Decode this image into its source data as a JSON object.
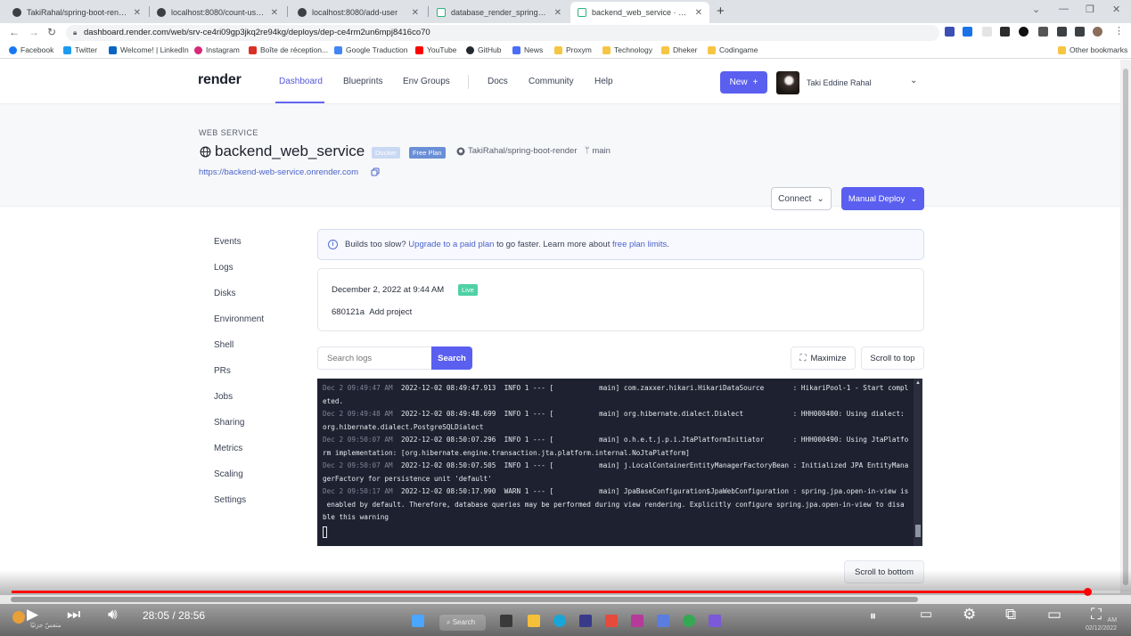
{
  "browser": {
    "tabs": [
      {
        "title": "TakiRahal/spring-boot-render: D",
        "favicon": "github-icon"
      },
      {
        "title": "localhost:8080/count-users",
        "favicon": "globe-icon"
      },
      {
        "title": "localhost:8080/add-user",
        "favicon": "globe-icon"
      },
      {
        "title": "database_render_spring_boot · D",
        "favicon": "render-icon"
      },
      {
        "title": "backend_web_service · Web Serv",
        "favicon": "render-icon",
        "active": true
      }
    ],
    "new_tab": "+",
    "window_controls": [
      "⌄",
      "—",
      "❐",
      "✕"
    ],
    "url": "dashboard.render.com/web/srv-ce4ri09gp3jkq2re94kg/deploys/dep-ce4rm2un6mpj8416co70",
    "bookmarks": [
      {
        "label": "Facebook",
        "color": "#1877f2"
      },
      {
        "label": "Twitter",
        "color": "#1d9bf0"
      },
      {
        "label": "Welcome! | LinkedIn",
        "color": "#0a66c2"
      },
      {
        "label": "Instagram",
        "color": "#d62976"
      },
      {
        "label": "Boîte de réception...",
        "color": "#d93025"
      },
      {
        "label": "Google Traduction",
        "color": "#4285f4"
      },
      {
        "label": "YouTube",
        "color": "#ff0000"
      },
      {
        "label": "GitHub",
        "color": "#24292f"
      },
      {
        "label": "News",
        "color": "#4a6cf7"
      },
      {
        "label": "Proxym",
        "color": "#f6c543"
      },
      {
        "label": "Technology",
        "color": "#f6c543"
      },
      {
        "label": "Dheker",
        "color": "#f6c543"
      },
      {
        "label": "Codingame",
        "color": "#f6c543"
      }
    ],
    "other_bookmarks": "Other bookmarks"
  },
  "render": {
    "logo": "render",
    "nav": [
      "Dashboard",
      "Blueprints",
      "Env Groups",
      "Docs",
      "Community",
      "Help"
    ],
    "new_button": "New",
    "new_button_icon": "+",
    "user_name": "Taki Eddine Rahal",
    "accent": "#5a5ff0"
  },
  "service": {
    "type": "WEB SERVICE",
    "name": "backend_web_service",
    "badge_runtime": "Docker",
    "badge_plan": "Free Plan",
    "repo": "TakiRahal/spring-boot-render",
    "branch": "main",
    "url": "https://backend-web-service.onrender.com",
    "connect_label": "Connect",
    "deploy_label": "Manual Deploy"
  },
  "sidebar": [
    "Events",
    "Logs",
    "Disks",
    "Environment",
    "Shell",
    "PRs",
    "Jobs",
    "Sharing",
    "Metrics",
    "Scaling",
    "Settings"
  ],
  "banner": {
    "prefix": "Builds too slow?",
    "link1": "Upgrade to a paid plan",
    "middle": "to go faster. Learn more about",
    "link2": "free plan limits",
    "suffix": "."
  },
  "deploy": {
    "date": "December 2, 2022 at 9:44 AM",
    "status": "Live",
    "commit_hash": "680121a",
    "commit_message": "Add project"
  },
  "logs_toolbar": {
    "search_placeholder": "Search logs",
    "search_button": "Search",
    "maximize": "Maximize",
    "scroll_top": "Scroll to top",
    "scroll_bottom": "Scroll to bottom"
  },
  "logs": [
    {
      "ts": "Dec 2 09:49:47 AM",
      "text": "  2022-12-02 08:49:47.913  INFO 1 --- [           main] com.zaxxer.hikari.HikariDataSource       : HikariPool-1 - Start compl"
    },
    {
      "ts": "",
      "text": "eted."
    },
    {
      "ts": "Dec 2 09:49:48 AM",
      "text": "  2022-12-02 08:49:48.699  INFO 1 --- [           main] org.hibernate.dialect.Dialect            : HHH000400: Using dialect:"
    },
    {
      "ts": "",
      "text": "org.hibernate.dialect.PostgreSQLDialect"
    },
    {
      "ts": "Dec 2 09:50:07 AM",
      "text": "  2022-12-02 08:50:07.296  INFO 1 --- [           main] o.h.e.t.j.p.i.JtaPlatformInitiator       : HHH000490: Using JtaPlatfo"
    },
    {
      "ts": "",
      "text": "rm implementation: [org.hibernate.engine.transaction.jta.platform.internal.NoJtaPlatform]"
    },
    {
      "ts": "Dec 2 09:50:07 AM",
      "text": "  2022-12-02 08:50:07.505  INFO 1 --- [           main] j.LocalContainerEntityManagerFactoryBean : Initialized JPA EntityMana"
    },
    {
      "ts": "",
      "text": "gerFactory for persistence unit 'default'"
    },
    {
      "ts": "Dec 2 09:50:17 AM",
      "text": "  2022-12-02 08:50:17.990  WARN 1 --- [           main] JpaBaseConfiguration$JpaWebConfiguration : spring.jpa.open-in-view is"
    },
    {
      "ts": "",
      "text": " enabled by default. Therefore, database queries may be performed during view rendering. Explicitly configure spring.jpa.open-in-view to disa"
    },
    {
      "ts": "",
      "text": "ble this warning"
    }
  ],
  "player": {
    "time": "28:05 / 28:56",
    "progress": 0.9706,
    "taskbar_search": "Search",
    "weather_text": "متفسّ جزئيًا",
    "tray_time": "AM",
    "tray_date": "02/12/2022"
  }
}
